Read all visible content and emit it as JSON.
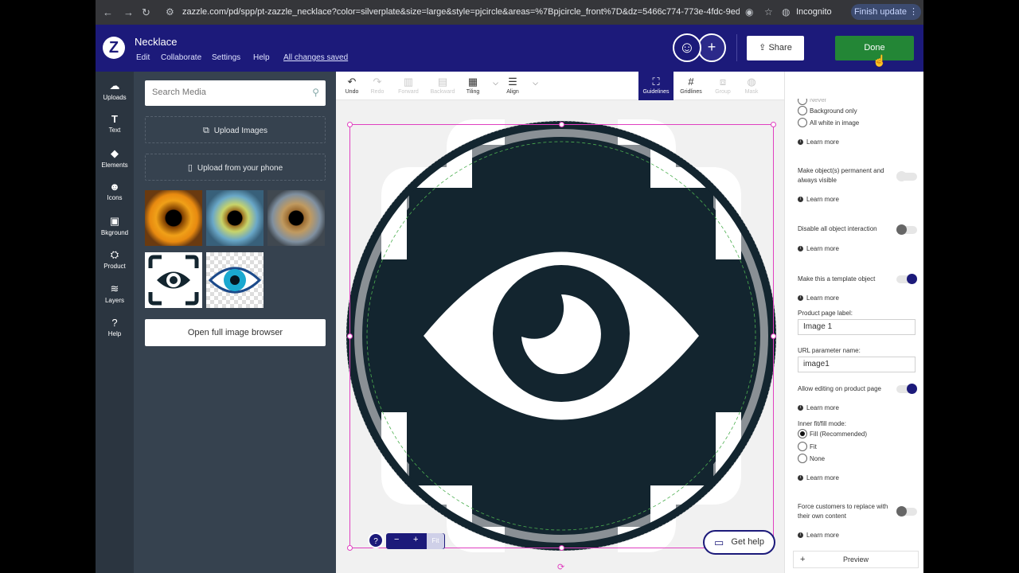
{
  "browser": {
    "url": "zazzle.com/pd/spp/pt-zazzle_necklace?color=silverplate&size=large&style=pjcircle&areas=%7Bpjcircle_front%7D&dz=5466c774-773e-4fdc-9ed...",
    "incognito_label": "Incognito",
    "update_label": "Finish update"
  },
  "header": {
    "logo": "Z",
    "product_title": "Necklace",
    "menu": [
      "Edit",
      "Collaborate",
      "Settings",
      "Help"
    ],
    "saved_status": "All changes saved",
    "share_label": "Share",
    "done_label": "Done"
  },
  "rail": [
    {
      "label": "Uploads",
      "icon": "upload-cloud-icon"
    },
    {
      "label": "Text",
      "icon": "text-icon"
    },
    {
      "label": "Elements",
      "icon": "elements-icon"
    },
    {
      "label": "Icons",
      "icon": "smiley-icon"
    },
    {
      "label": "Bkground",
      "icon": "background-icon"
    },
    {
      "label": "Product",
      "icon": "product-icon"
    },
    {
      "label": "Layers",
      "icon": "layers-icon"
    },
    {
      "label": "Help",
      "icon": "help-icon"
    }
  ],
  "media": {
    "search_placeholder": "Search Media",
    "upload_images": "Upload Images",
    "upload_phone": "Upload from your phone",
    "browse_label": "Open full image browser"
  },
  "toolbar": {
    "items": [
      "Undo",
      "Redo",
      "Forward",
      "Backward",
      "Tiling",
      "Align",
      "Guidelines",
      "Gridlines",
      "Group",
      "Mask"
    ]
  },
  "canvas": {
    "zoom_fit": "Fit",
    "help_label": "Get help"
  },
  "panel": {
    "radio_top": [
      "Never",
      "Background only",
      "All white in image"
    ],
    "learn_more": "Learn more",
    "permanent_label": "Make object(s) permanent and always visible",
    "disable_label": "Disable all object interaction",
    "template_label": "Make this a template object",
    "page_label_title": "Product page label:",
    "page_label_value": "Image 1",
    "url_param_title": "URL parameter name:",
    "url_param_value": "image1",
    "allow_edit_label": "Allow editing on product page",
    "fit_mode_title": "Inner fit/fill mode:",
    "fit_options": [
      "Fill (Recommended)",
      "Fit",
      "None"
    ],
    "force_label": "Force customers to replace with their own content",
    "preview_label": "Preview"
  },
  "colors": {
    "brand": "#1c1a7a",
    "done": "#238636",
    "selection": "#e040c0",
    "design_dark": "#13252f"
  }
}
